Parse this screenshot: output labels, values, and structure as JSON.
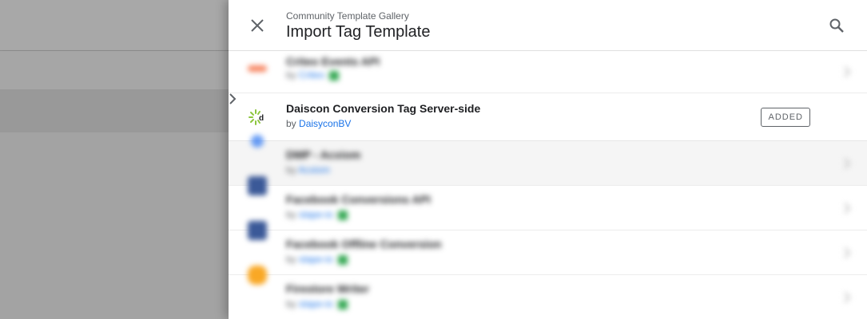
{
  "header": {
    "subtitle": "Community Template Gallery",
    "title": "Import Tag Template"
  },
  "rows": [
    {
      "name": "Criteo Events API",
      "by": "by",
      "author": "Criteo",
      "icon_color": "#f4511e"
    },
    {
      "name": "Daiscon Conversion Tag Server-side",
      "by": "by",
      "author": "DaisyconBV",
      "status": "ADDED"
    },
    {
      "name": "DMP - Acxiom",
      "by": "by",
      "author": "Acxiom",
      "icon_color": "#4285f4"
    },
    {
      "name": "Facebook Conversions API",
      "by": "by",
      "author": "stape-io",
      "icon_color": "#3b5998"
    },
    {
      "name": "Facebook Offline Conversion",
      "by": "by",
      "author": "stape-io",
      "icon_color": "#3b5998"
    },
    {
      "name": "Firestore Writer",
      "by": "by",
      "author": "stape-io",
      "icon_color": "#f9a825"
    }
  ],
  "colors": {
    "link": "#1a73e8",
    "verified_badge": "#34a853"
  }
}
